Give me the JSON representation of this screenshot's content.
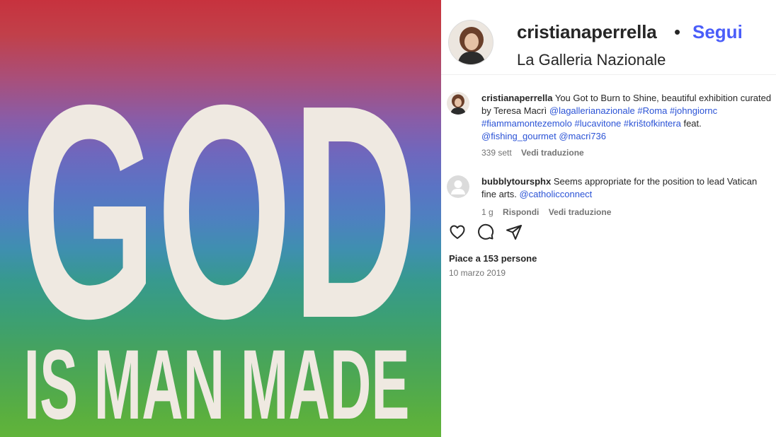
{
  "image": {
    "headline": "GOD",
    "subline": "IS MAN MADE"
  },
  "header": {
    "username": "cristianaperrella",
    "separator": "•",
    "follow_label": "Segui",
    "location": "La Galleria Nazionale"
  },
  "caption": {
    "username": "cristianaperrella",
    "text_1": "You Got to Burn to Shine, beautiful exhibition curated by Teresa Macrì",
    "mentions_1": [
      "@lagallerianazionale",
      "#Roma",
      "#johngiornc"
    ],
    "mentions_2": [
      "#fiammamontezemolo",
      "#lucavitone",
      "#krištofkintera"
    ],
    "text_2": "feat.",
    "mentions_3": [
      "@fishing_gourmet",
      "@macri736"
    ],
    "time": "339 sett",
    "translate": "Vedi traduzione"
  },
  "comment": {
    "username": "bubblytoursphx",
    "text": "Seems appropriate for the position to lead Vatican fine arts.",
    "mention": "@catholicconnect",
    "time": "1 g",
    "reply": "Rispondi",
    "translate": "Vedi traduzione"
  },
  "actions": {
    "icons": [
      "heart-icon",
      "comment-icon",
      "share-icon"
    ]
  },
  "likes_text": "Piace a 153 persone",
  "date": "10 marzo 2019",
  "colors": {
    "follow": "#4a5df9",
    "link": "#2b53d6",
    "meta": "#737373"
  }
}
